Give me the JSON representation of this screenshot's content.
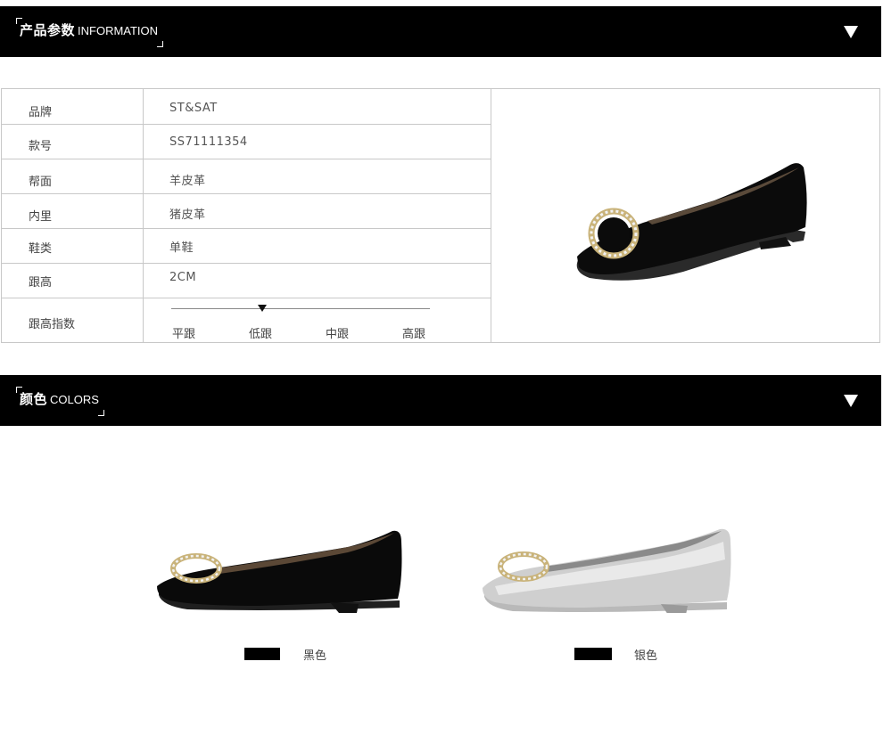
{
  "section_info": {
    "title_cn": "产品参数",
    "title_en": "INFORMATION"
  },
  "params": [
    {
      "label": "品牌",
      "value": "ST&SAT"
    },
    {
      "label": "款号",
      "value": "SS71111354"
    },
    {
      "label": "帮面",
      "value": "羊皮革"
    },
    {
      "label": "内里",
      "value": "猪皮革"
    },
    {
      "label": "鞋类",
      "value": "单鞋"
    },
    {
      "label": "跟高",
      "value": "2CM"
    }
  ],
  "heel_index": {
    "label": "跟高指数",
    "levels": [
      "平跟",
      "低跟",
      "中跟",
      "高跟"
    ],
    "selected": "低跟",
    "selected_index": 1
  },
  "section_colors": {
    "title_cn": "颜色",
    "title_en": "COLORS"
  },
  "color_options": [
    {
      "name": "黑色",
      "swatch": "#000000"
    },
    {
      "name": "银色",
      "swatch": "#000000"
    }
  ],
  "icons": {
    "section_toggle": "triangle-down-icon"
  }
}
